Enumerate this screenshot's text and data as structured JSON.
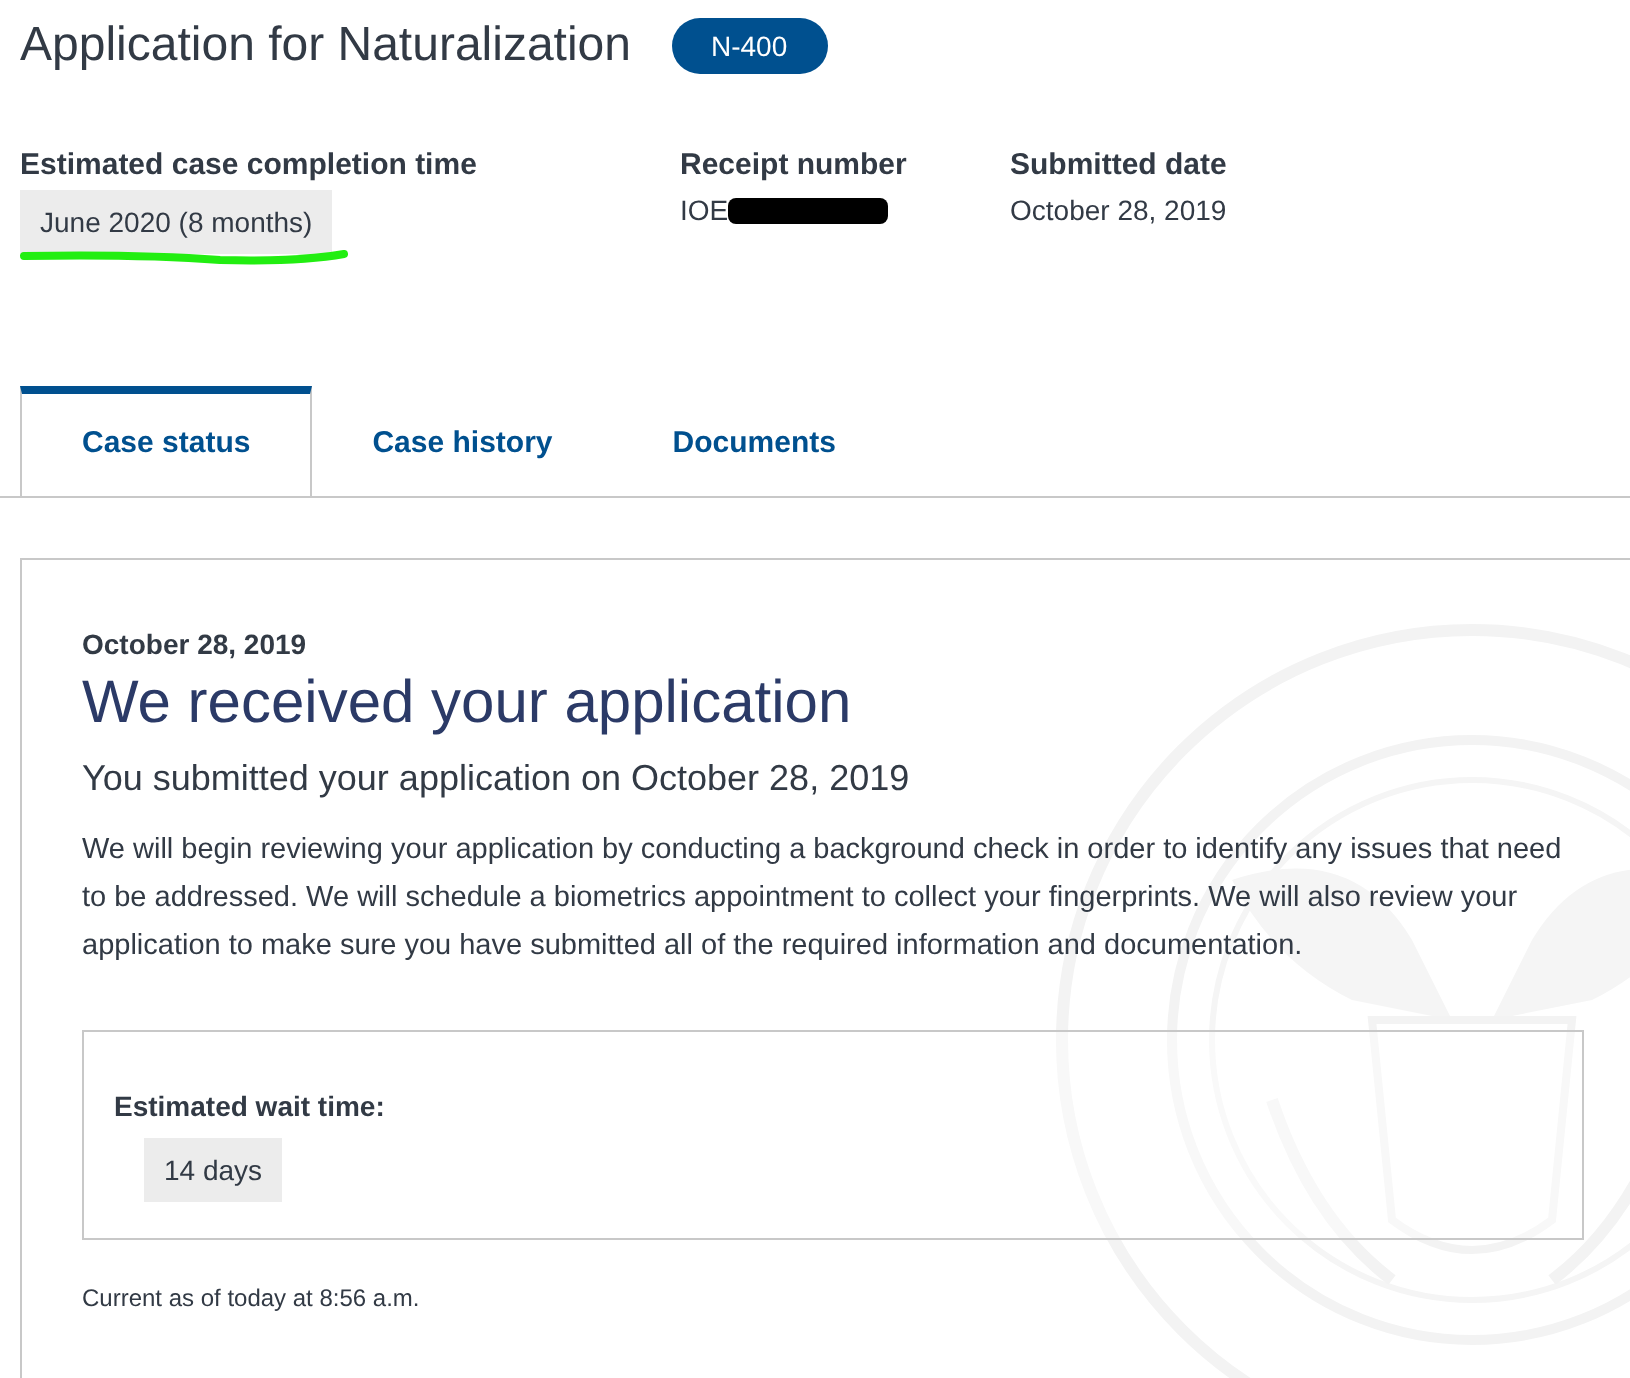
{
  "header": {
    "title": "Application for Naturalization",
    "form_badge": "N-400"
  },
  "summary": [
    {
      "label": "Estimated case completion time",
      "value": "June 2020 (8 months)",
      "kind": "chip",
      "underlined": true
    },
    {
      "label": "Receipt number",
      "value": "IOE",
      "kind": "redacted"
    },
    {
      "label": "Submitted date",
      "value": "October 28, 2019",
      "kind": "plain"
    }
  ],
  "tabs": [
    {
      "label": "Case status",
      "selected": true
    },
    {
      "label": "Case history",
      "selected": false
    },
    {
      "label": "Documents",
      "selected": false
    }
  ],
  "status": {
    "date": "October 28, 2019",
    "heading": "We received your application",
    "subheading": "You submitted your application on October 28, 2019",
    "body": "We will begin reviewing your application by conducting a background check in order to identify any issues that need to be addressed. We will schedule a biometrics appointment to collect your fingerprints. We will also review your application to make sure you have submitted all of the required information and documentation.",
    "wait_label": "Estimated wait time:",
    "wait_value": "14 days",
    "footnote": "Current as of today at 8:56 a.m."
  }
}
